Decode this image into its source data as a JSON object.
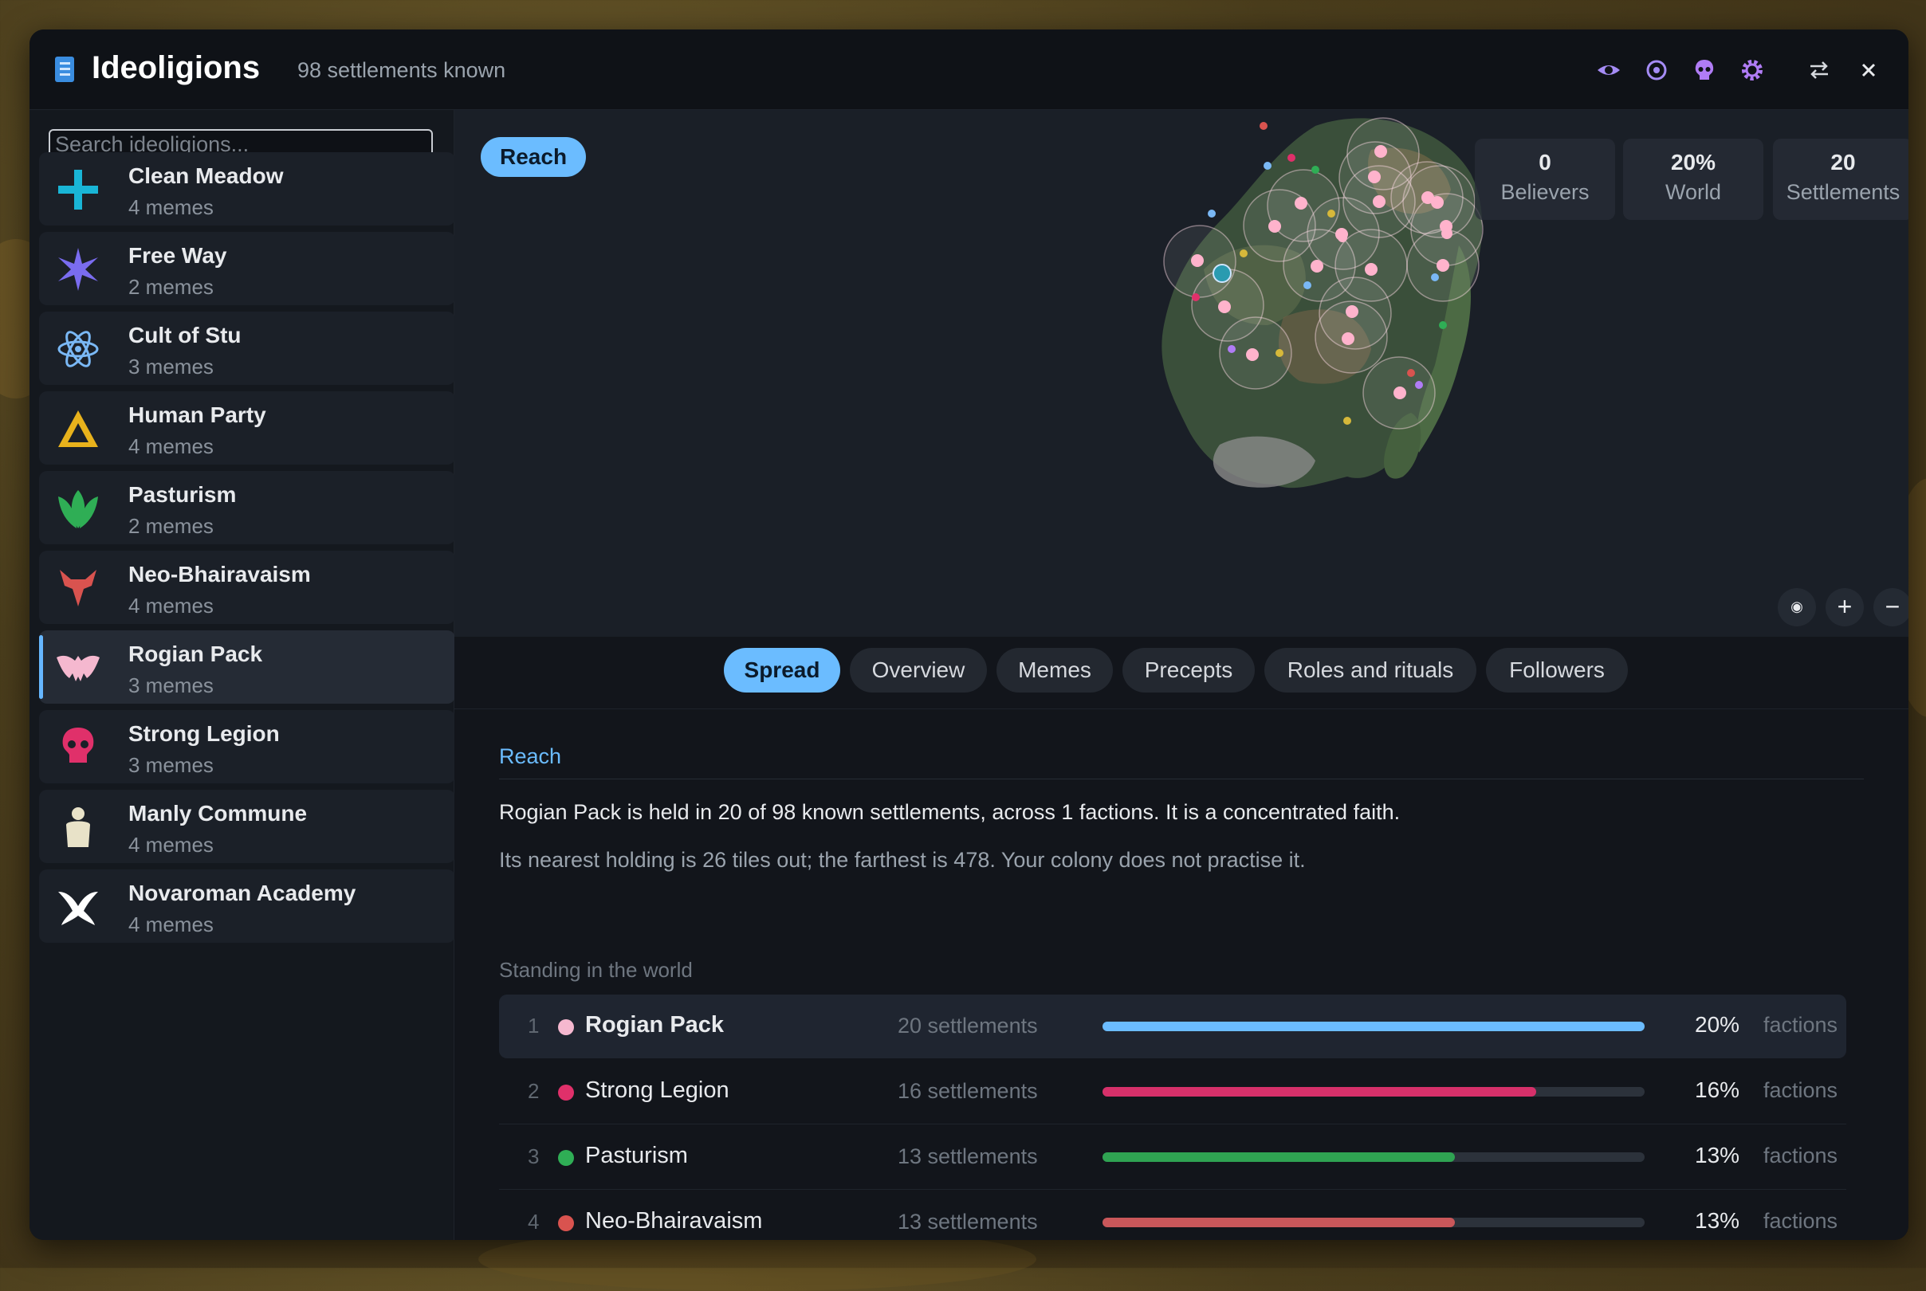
{
  "window": {
    "title": "Ideoligions",
    "subtitle": "98 settlements known",
    "icons": [
      "eye-icon",
      "target-icon",
      "skull-icon",
      "gear-icon",
      "swap-icon",
      "close-icon"
    ]
  },
  "sidebar": {
    "search_placeholder": "Search ideoligions...",
    "items": [
      {
        "name": "Clean Meadow",
        "memes": "4 memes",
        "icon": "cross-icon",
        "color": "#19b5d6"
      },
      {
        "name": "Free Way",
        "memes": "2 memes",
        "icon": "star-burst-icon",
        "color": "#7a6cf0"
      },
      {
        "name": "Cult of Stu",
        "memes": "3 memes",
        "icon": "atom-icon",
        "color": "#7ab8f5"
      },
      {
        "name": "Human Party",
        "memes": "4 memes",
        "icon": "triangle-icon",
        "color": "#e8b21c"
      },
      {
        "name": "Pasturism",
        "memes": "2 memes",
        "icon": "lotus-icon",
        "color": "#2fae55"
      },
      {
        "name": "Neo-Bhairavaism",
        "memes": "4 memes",
        "icon": "demon-icon",
        "color": "#d9534f"
      },
      {
        "name": "Rogian Pack",
        "memes": "3 memes",
        "icon": "bat-icon",
        "color": "#f5b8cf",
        "selected": true
      },
      {
        "name": "Strong Legion",
        "memes": "3 memes",
        "icon": "skull-icon",
        "color": "#e0306a"
      },
      {
        "name": "Manly Commune",
        "memes": "4 memes",
        "icon": "figure-icon",
        "color": "#e8e2c8"
      },
      {
        "name": "Novaroman Academy",
        "memes": "4 memes",
        "icon": "wings-icon",
        "color": "#ffffff"
      }
    ]
  },
  "map": {
    "pill": "Reach",
    "stats": [
      {
        "value": "0",
        "label": "Believers"
      },
      {
        "value": "20%",
        "label": "World"
      },
      {
        "value": "20",
        "label": "Settlements"
      }
    ],
    "zoom": {
      "reset": "◉",
      "in": "+",
      "out": "−"
    }
  },
  "tabs": [
    "Spread",
    "Overview",
    "Memes",
    "Precepts",
    "Roles and rituals",
    "Followers"
  ],
  "active_tab": "Spread",
  "reach": {
    "title": "Reach",
    "para1": "Rogian Pack is held in 20 of 98 known settlements, across 1 factions. It is a concentrated faith.",
    "para2": "Its nearest holding is 26 tiles out; the farthest is 478. Your colony does not practise it.",
    "standing_label": "Standing in the world",
    "rows": [
      {
        "rank": "1",
        "name": "Rogian Pack",
        "count": "20 settlements",
        "pct": "20%",
        "unit": "factions",
        "share": 1.0,
        "color": "#6bbcff",
        "dot": "#f5b8cf"
      },
      {
        "rank": "2",
        "name": "Strong Legion",
        "count": "16 settlements",
        "pct": "16%",
        "unit": "factions",
        "share": 0.8,
        "color": "#d6306a",
        "dot": "#e0306a"
      },
      {
        "rank": "3",
        "name": "Pasturism",
        "count": "13 settlements",
        "pct": "13%",
        "unit": "factions",
        "share": 0.65,
        "color": "#2fa352",
        "dot": "#2fae55"
      },
      {
        "rank": "4",
        "name": "Neo-Bhairavaism",
        "count": "13 settlements",
        "pct": "13%",
        "unit": "factions",
        "share": 0.65,
        "color": "#c9575a",
        "dot": "#d9534f"
      }
    ]
  }
}
